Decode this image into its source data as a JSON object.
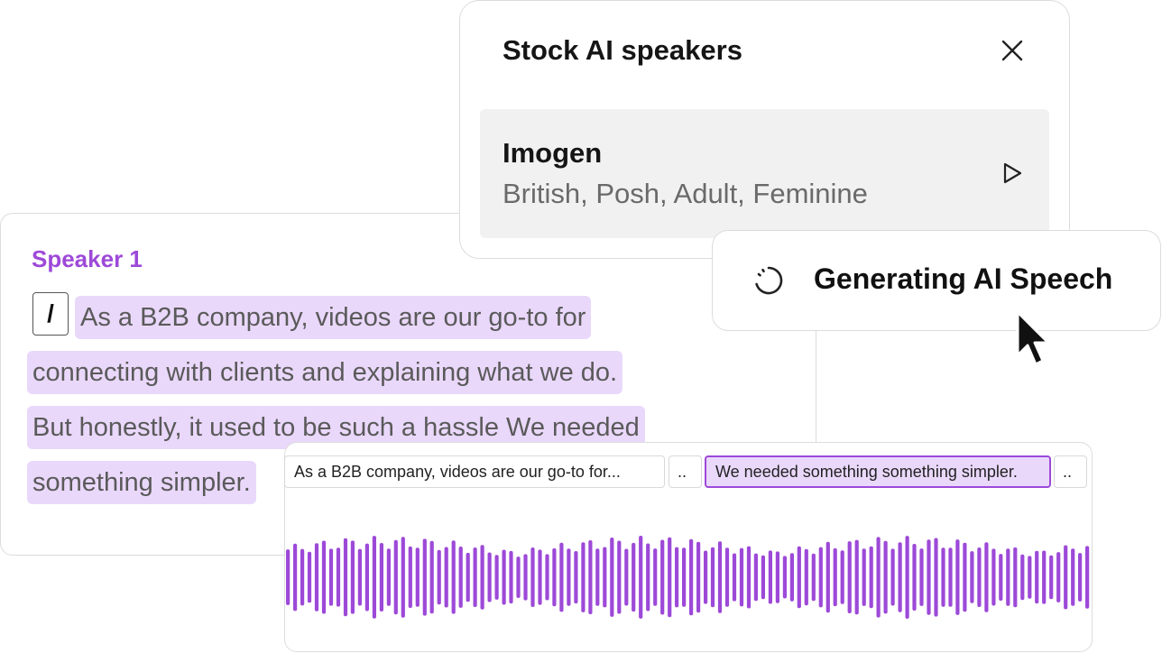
{
  "script_card": {
    "speaker_label": "Speaker 1",
    "slash_key": "/",
    "lines": [
      "As a B2B company, videos are our go-to for",
      "connecting with clients and explaining what we do.",
      "But honestly, it used to be such a hassle  We needed",
      "something simpler."
    ]
  },
  "speakers_panel": {
    "title": "Stock AI speakers",
    "voice": {
      "name": "Imogen",
      "tags": "British, Posh, Adult, Feminine"
    }
  },
  "toast": {
    "text": "Generating AI Speech"
  },
  "timeline": {
    "segments": [
      "As a B2B company, videos are our go-to for...",
      "..",
      "We needed something something simpler.",
      ".."
    ],
    "active_segment": 2
  },
  "icons": {
    "close": "close-icon",
    "play": "play-icon",
    "spinner": "loading-spinner-icon",
    "cursor": "mouse-pointer-icon"
  },
  "colors": {
    "accent": "#9d49d8",
    "highlight": "#ead8fb",
    "waveform": "#9d49d8"
  }
}
